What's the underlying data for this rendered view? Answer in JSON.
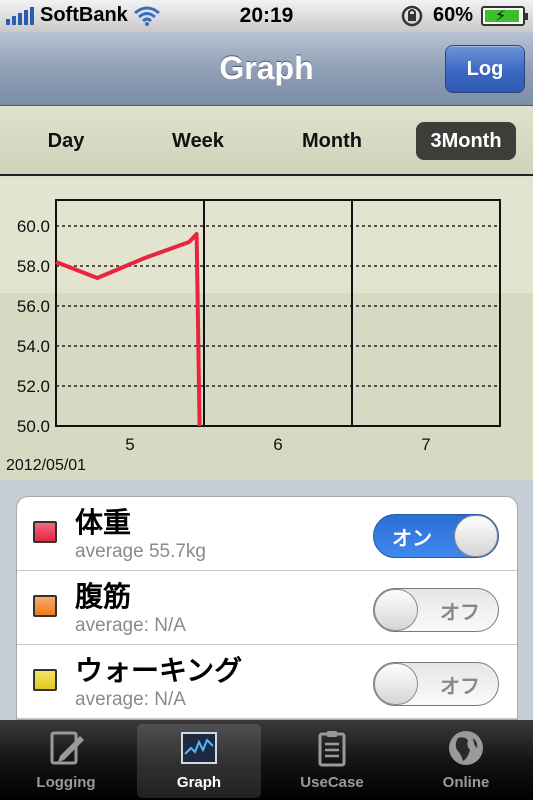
{
  "status_bar": {
    "carrier": "SoftBank",
    "time": "20:19",
    "battery_percent": "60%",
    "battery_level": 0.6
  },
  "navbar": {
    "title": "Graph",
    "log_button": "Log"
  },
  "segments": {
    "items": [
      "Day",
      "Week",
      "Month",
      "3Month"
    ],
    "selected": "3Month"
  },
  "chart_data": {
    "type": "line",
    "ylim": [
      50.0,
      60.0
    ],
    "yticks": [
      "60.0",
      "58.0",
      "56.0",
      "54.0",
      "52.0",
      "50.0"
    ],
    "xtick_labels": [
      "5",
      "6",
      "7"
    ],
    "start_date": "2012/05/01",
    "grid": true,
    "series": [
      {
        "color": "#e8243f",
        "x": [
          0.0,
          0.28,
          0.6,
          0.9,
          0.95,
          0.97
        ],
        "y": [
          58.2,
          57.4,
          58.4,
          59.2,
          59.6,
          50.0
        ]
      }
    ]
  },
  "items": [
    {
      "title": "体重",
      "subtitle": "average 55.7kg",
      "color": "#e8385a",
      "toggle": "オン",
      "on": true
    },
    {
      "title": "腹筋",
      "subtitle": "average: N/A",
      "color": "#f08a2c",
      "toggle": "オフ",
      "on": false
    },
    {
      "title": "ウォーキング",
      "subtitle": "average: N/A",
      "color": "#e9d22c",
      "toggle": "オフ",
      "on": false
    }
  ],
  "tabbar": {
    "items": [
      {
        "label": "Logging",
        "icon": "pencil-icon"
      },
      {
        "label": "Graph",
        "icon": "graph-icon"
      },
      {
        "label": "UseCase",
        "icon": "clipboard-icon"
      },
      {
        "label": "Online",
        "icon": "globe-icon"
      }
    ],
    "selected": "Graph"
  }
}
